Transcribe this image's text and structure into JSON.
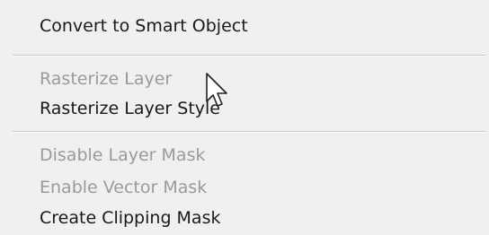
{
  "menu": {
    "items": [
      {
        "label": "Convert to Smart Object",
        "enabled": true
      },
      {
        "label": "Rasterize Layer",
        "enabled": false
      },
      {
        "label": "Rasterize Layer Style",
        "enabled": true
      },
      {
        "label": "Disable Layer Mask",
        "enabled": false
      },
      {
        "label": "Enable Vector Mask",
        "enabled": false
      },
      {
        "label": "Create Clipping Mask",
        "enabled": true
      }
    ]
  },
  "cursor": {
    "icon": "arrow-pointer-icon"
  },
  "colors": {
    "background": "#f0f0f0",
    "text_enabled": "#1a1a1a",
    "text_disabled": "#9a9a9a",
    "separator": "#c7c7c7"
  }
}
